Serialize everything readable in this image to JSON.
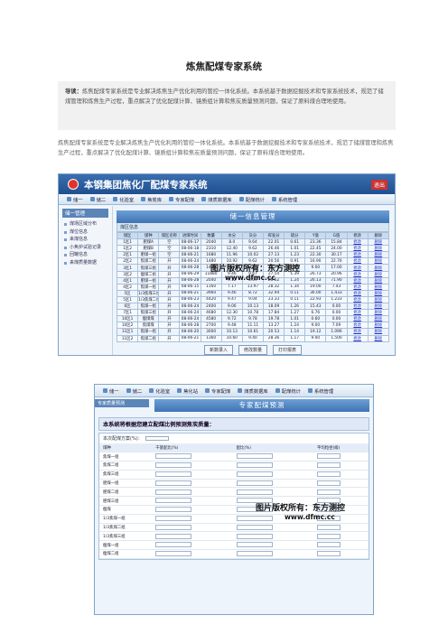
{
  "article": {
    "title": "炼焦配煤专家系统",
    "lead_label": "导读：",
    "lead_text": "炼焦配煤专家系统是专业解决炼焦生产优化利用的管控一体化系统。本系统基于数据挖掘技术和专家系统技术，规范了储煤管理和炼焦生产过程，重点解决了优化配煤计算、镜质组计算和焦炭质量预测问题，保证了原料煤合理地使用。",
    "body_text": "炼焦配煤专家系统是专业解决炼焦生产优化利用的管控一体化系统。本系统基于数据挖掘技术和专家系统技术，规范了储煤管理和炼焦生产过程，重点解决了优化配煤计算、镜质组计算和焦炭质量预测问题，保证了原料煤合理地使用。"
  },
  "screen1": {
    "app_title": "本钢集团焦化厂配煤专家系统",
    "exit_label": "退出",
    "nav": [
      "储一",
      "储二",
      "化验室",
      "焦炭库",
      "专家配煤",
      "煤质数据库",
      "配煤统计",
      "系统管理"
    ],
    "sidebar_header": "储一管理",
    "sidebar_items": [
      "煤场区域分布",
      "煤位信息",
      "来煤信息",
      "小焦炉试验记录",
      "回罐信息",
      "来煤质量数据"
    ],
    "panel_title": "储一信息管理",
    "sub_label": "煤区信息",
    "table_headers": [
      "煤区",
      "煤种",
      "煤区名称",
      "进煤时间",
      "数量",
      "水分",
      "灰分",
      "挥发分",
      "硫分",
      "Y值",
      "G值",
      "修改",
      "删除"
    ],
    "rows": [
      [
        "1区1",
        "肥煤A",
        "空",
        "08-06-17",
        "2040",
        "8.0",
        "9.64",
        "22.01",
        "0.61",
        "23.36",
        "15.84",
        "修改",
        "删除"
      ],
      [
        "1区2",
        "肥煤B",
        "空",
        "08-06-18",
        "2310",
        "12.40",
        "9.62",
        "26.46",
        "1.01",
        "22.45",
        "24.00",
        "修改",
        "删除"
      ],
      [
        "2区1",
        "肥煤一组",
        "空",
        "08-06-21",
        "1680",
        "11.96",
        "10.02",
        "27.13",
        "1.23",
        "22.30",
        "30.17",
        "修改",
        "删除"
      ],
      [
        "2区2",
        "焦煤二组",
        "开",
        "08-06-24",
        "1480",
        "10.92",
        "9.62",
        "20.56",
        "0.91",
        "16.90",
        "22.76",
        "修改",
        "删除"
      ],
      [
        "3区1",
        "焦煤三组",
        "开",
        "08-06-28",
        "1420",
        "12.83",
        "11.10",
        "20.96",
        "1.36",
        "9.00",
        "17.00",
        "修改",
        "删除"
      ],
      [
        "3区2",
        "瘦煤二组",
        "开",
        "08-06-29",
        "11880",
        "9.46",
        "9.67",
        "27.54",
        "1.39",
        "26.73",
        "20.96",
        "修改",
        "删除"
      ],
      [
        "4区1",
        "肥煤一组",
        "开",
        "08-06-28",
        "2040",
        "9.12",
        "8.59",
        "26.62",
        "1.24",
        "26.13",
        "71.90",
        "修改",
        "删除"
      ],
      [
        "4区2",
        "焦煤一组",
        "开",
        "08-06-15",
        "1160",
        "7.17",
        "13.97",
        "28.32",
        "1.34",
        "19.00",
        "7.43",
        "修改",
        "删除"
      ],
      [
        "5区",
        "1/3焦煤三组",
        "开",
        "08-06-21",
        "3960",
        "9.46",
        "8.72",
        "32.94",
        "0.11",
        "36.00",
        "1.433",
        "修改",
        "删除"
      ],
      [
        "5区1",
        "1/3焦煤二组",
        "开",
        "08-06-23",
        "4420",
        "9.47",
        "9.04",
        "23.33",
        "0.11",
        "22.93",
        "1.233",
        "修改",
        "删除"
      ],
      [
        "6区",
        "焦煤一组",
        "开",
        "08-06-24",
        "2400",
        "9.06",
        "10.13",
        "18.09",
        "1.26",
        "15.43",
        "0.00",
        "修改",
        "删除"
      ],
      [
        "7区1",
        "焦煤三组",
        "开",
        "08-06-24",
        "4680",
        "12.30",
        "10.78",
        "17.84",
        "1.27",
        "6.76",
        "0.00",
        "修改",
        "删除"
      ],
      [
        "10区1",
        "瘦煤煤",
        "开",
        "08-06-24",
        "4580",
        "9.72",
        "9.78",
        "19.78",
        "1.01",
        "0.60",
        "0.00",
        "修改",
        "删除"
      ],
      [
        "10区2",
        "焦煤煤",
        "开",
        "08-06-28",
        "2700",
        "9.48",
        "11.11",
        "13.27",
        "1.24",
        "9.00",
        "7.09",
        "修改",
        "删除"
      ],
      [
        "11区1",
        "焦煤一组",
        "开",
        "08-06-20",
        "3000",
        "10.13",
        "10.61",
        "20.53",
        "1.14",
        "19.12",
        "1.096",
        "修改",
        "删除"
      ],
      [
        "11区2",
        "焦煤二组",
        "开",
        "08-06-21",
        "1360",
        "10.60",
        "9.40",
        "28.36",
        "1.17",
        "9.00",
        "1.500",
        "修改",
        "删除"
      ]
    ],
    "buttons": [
      "新数录入",
      "修改数量",
      "打印报表"
    ],
    "watermark_text": "图片版权所有：东方测控",
    "watermark_url": "www.dfmc.cc"
  },
  "screen2": {
    "nav": [
      "储一",
      "储二",
      "化验室",
      "焦化站",
      "专家配煤",
      "煤质数据库",
      "配煤统计",
      "系统管理"
    ],
    "sidebar_header": "专家质量预测",
    "panel_title": "专家配煤预测",
    "question": "本系统将根据您建立配煤比例预测焦炭质量：",
    "form_label": "本次配煤方案(%)：",
    "form_headers": [
      "煤种",
      "干基配比(%)",
      "配比(%)",
      "平均粒径(级)"
    ],
    "form_rows": [
      "焦煤一组",
      "焦煤二组",
      "焦煤三组",
      "肥煤一组",
      "肥煤二组",
      "肥煤三组",
      "瘦煤",
      "1/3焦煤一组",
      "1/3焦煤二组",
      "1/3焦煤三组",
      "瘦煤一组",
      "瘦煤二组"
    ],
    "watermark_text": "图片版权所有：东方测控",
    "watermark_url": "www.dfmc.cc"
  }
}
